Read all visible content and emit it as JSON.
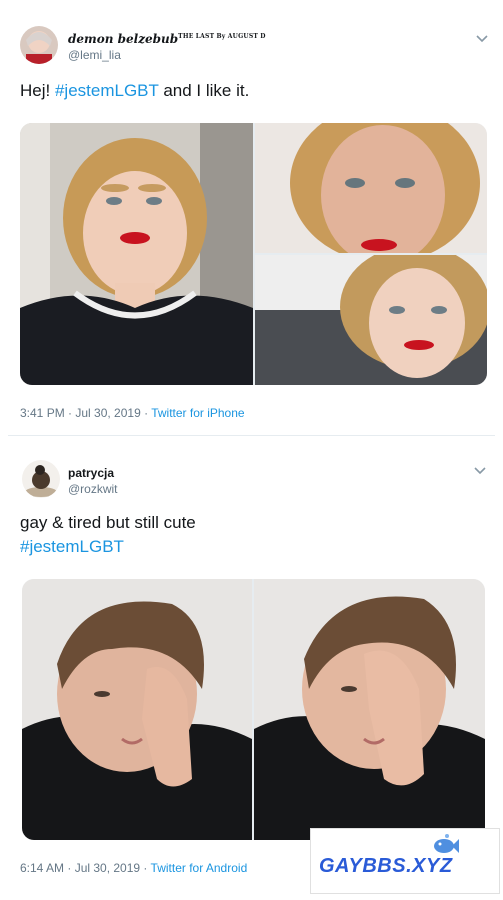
{
  "tweet1": {
    "display_name": "demon belzebub",
    "name_suffix": "THE LAST By AUGUST D",
    "handle": "@lemi_lia",
    "text_prefix": "Hej! ",
    "hashtag": "#jestemLGBT",
    "text_suffix": " and I like it.",
    "timestamp": "3:41 PM · Jul 30, 2019 · ",
    "source": "Twitter for iPhone"
  },
  "tweet2": {
    "display_name": "patrycja",
    "handle": "@rozkwit",
    "text_line1": "gay & tired but still cute",
    "hashtag": "#jestemLGBT",
    "timestamp": "6:14 AM · Jul 30, 2019 · ",
    "source": "Twitter for Android"
  },
  "watermark": {
    "text": "GAYBBS.XYZ"
  },
  "icons": [
    "chevron-down-icon",
    "avatar",
    "photo"
  ],
  "colors": {
    "link": "#1b95e0",
    "secondary": "#657786",
    "divider": "#e6ecf0",
    "watermark": "#2a5bd7"
  }
}
